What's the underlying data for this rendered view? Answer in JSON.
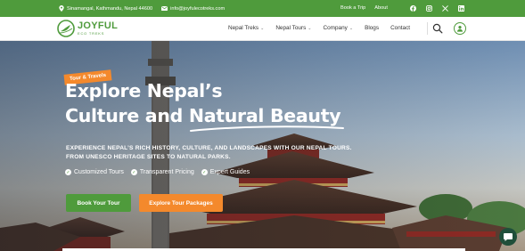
{
  "topbar": {
    "address": "Sinamangal, Kathmandu, Nepal 44600",
    "email": "info@joyfulecotreks.com",
    "links": [
      "Book a Trip",
      "About"
    ],
    "socials": [
      "facebook-icon",
      "instagram-icon",
      "x-icon",
      "linkedin-icon"
    ],
    "bg_color": "#4f9b3c"
  },
  "header": {
    "logo_name": "JOYFUL",
    "logo_tagline": "ECO TREKS",
    "nav": [
      {
        "label": "Nepal Treks"
      },
      {
        "label": "Nepal Tours"
      },
      {
        "label": "Company"
      },
      {
        "label": "Blogs"
      },
      {
        "label": "Contact"
      }
    ]
  },
  "hero": {
    "badge": "Tour & Travels",
    "title_line1": "Explore Nepal’s",
    "title_line2": "Culture and Natural Beauty",
    "subtitle_line1": "EXPERIENCE NEPAL’S RICH HISTORY, CULTURE, AND LANDSCAPES WITH OUR NEPAL TOURS.",
    "subtitle_line2": "FROM UNESCO HERITAGE SITES TO NATURAL PARKS.",
    "features": [
      "Customized Tours",
      "Transparent Pricing",
      "Expert Guides"
    ],
    "primary_button": "Book Your Tour",
    "secondary_button": "Explore Tour Packages"
  },
  "colors": {
    "brand_green": "#4f9b3c",
    "accent_orange": "#f4892c",
    "temple_red": "#8e2a24",
    "chat_button": "#1f4f3a"
  }
}
